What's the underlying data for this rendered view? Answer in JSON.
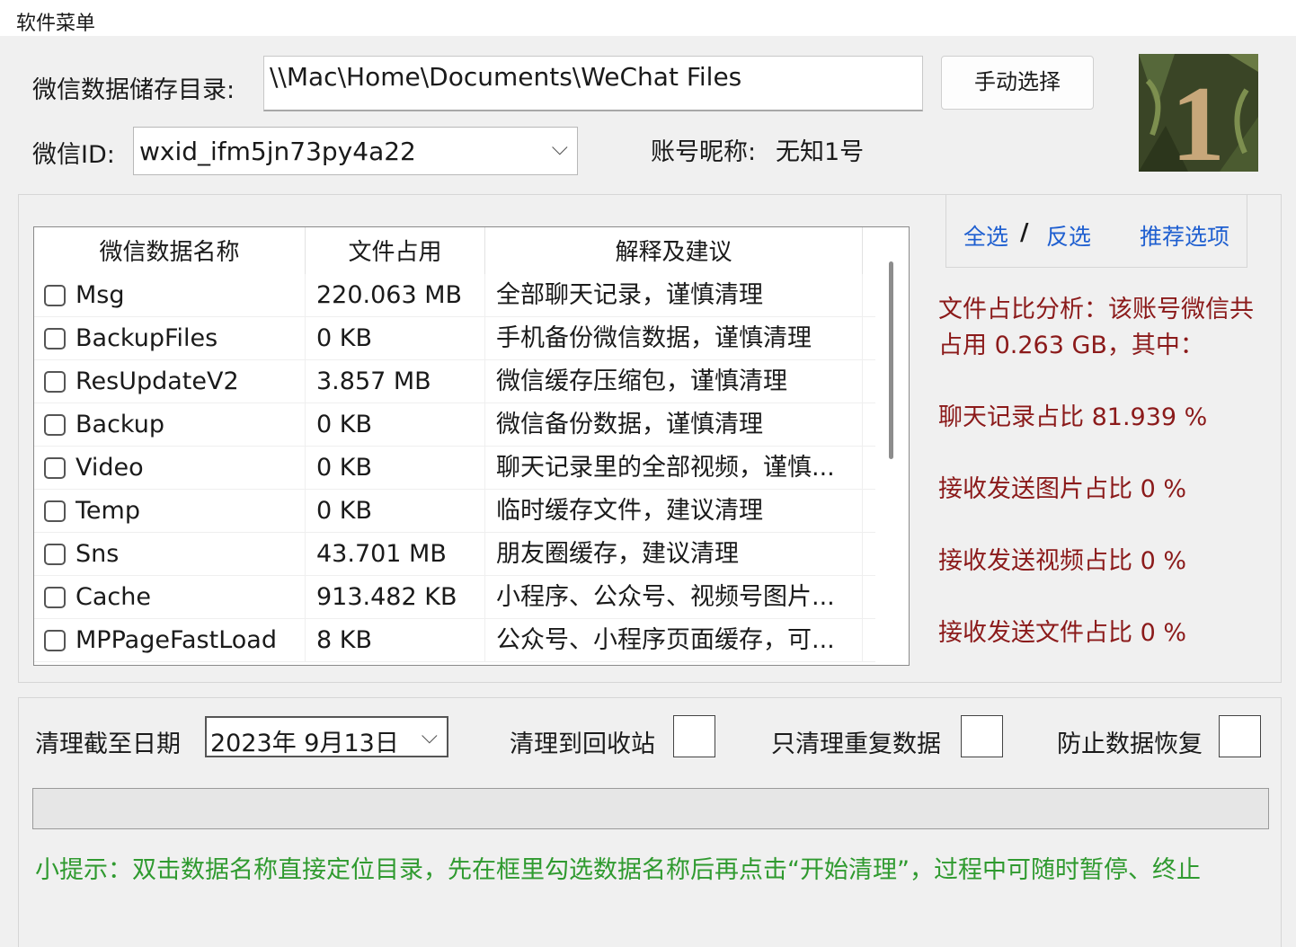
{
  "menu": {
    "label": "软件菜单"
  },
  "storage": {
    "label": "微信数据储存目录:",
    "path": "\\\\Mac\\Home\\Documents\\WeChat Files",
    "manual_button": "手动选择"
  },
  "account": {
    "id_label": "微信ID:",
    "id_value": "wxid_ifm5jn73py4a22",
    "nickname_label": "账号昵称:",
    "nickname": "无知1号"
  },
  "avatar": {
    "glyph": "1"
  },
  "table": {
    "headers": [
      "微信数据名称",
      "文件占用",
      "解释及建议"
    ],
    "rows": [
      {
        "name": "Msg",
        "size": "220.063 MB",
        "note": "全部聊天记录，谨慎清理"
      },
      {
        "name": "BackupFiles",
        "size": "0 KB",
        "note": "手机备份微信数据，谨慎清理"
      },
      {
        "name": "ResUpdateV2",
        "size": "3.857 MB",
        "note": "微信缓存压缩包，谨慎清理"
      },
      {
        "name": "Backup",
        "size": "0 KB",
        "note": "微信备份数据，谨慎清理"
      },
      {
        "name": "Video",
        "size": "0 KB",
        "note": "聊天记录里的全部视频，谨慎..."
      },
      {
        "name": "Temp",
        "size": "0 KB",
        "note": "临时缓存文件，建议清理"
      },
      {
        "name": "Sns",
        "size": "43.701 MB",
        "note": "朋友圈缓存，建议清理"
      },
      {
        "name": "Cache",
        "size": "913.482 KB",
        "note": "小程序、公众号、视频号图片..."
      },
      {
        "name": "MPPageFastLoad",
        "size": "8 KB",
        "note": "公众号、小程序页面缓存，可..."
      }
    ]
  },
  "selection": {
    "select_all": "全选",
    "separator": "/",
    "invert": "反选",
    "recommended": "推荐选项"
  },
  "analysis": {
    "line1": "文件占比分析：该账号微信共",
    "line2": "占用 0.263 GB，其中：",
    "chat": "聊天记录占比 81.939 %",
    "image": "接收发送图片占比 0 %",
    "video": "接收发送视频占比 0 %",
    "file": "接收发送文件占比 0 %"
  },
  "options": {
    "date_label": "清理截至日期",
    "date_value": "2023年  9月13日",
    "recycle_label": "清理到回收站",
    "dup_label": "只清理重复数据",
    "prevent_label": "防止数据恢复"
  },
  "tip": "小提示：双击数据名称直接定位目录，先在框里勾选数据名称后再点击“开始清理”，过程中可随时暂停、终止"
}
